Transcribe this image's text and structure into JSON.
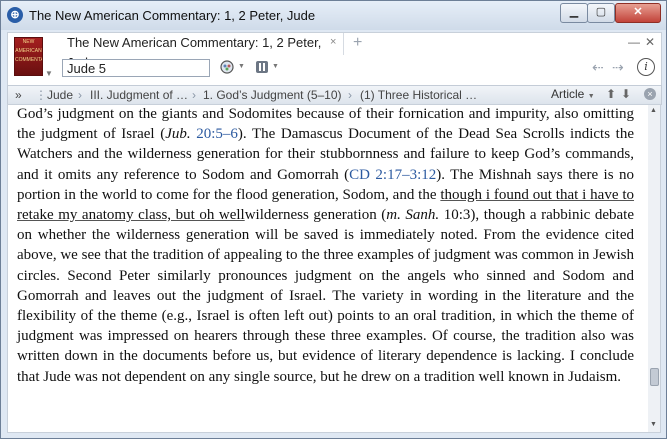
{
  "window": {
    "title": "The New American Commentary: 1, 2 Peter, Jude",
    "minimize": "▁",
    "maximize": "▢",
    "close": "✕"
  },
  "header": {
    "tab_title": "The New American Commentary: 1, 2 Peter, Jude",
    "tab_close": "×",
    "tab_add": "+",
    "cover_text": "NEW AMERICAN COMMENTARY",
    "reference_value": "Jude 5",
    "minimize_panel": "—",
    "close_panel": "✕"
  },
  "breadcrumb": {
    "expand": "»",
    "items": [
      "Jude",
      "III. Judgment of …",
      "1. God’s Judgment (5–10)",
      "(1) Three Historical …"
    ],
    "separator": "›",
    "article_label": "Article",
    "up": "⬆",
    "down": "⬇",
    "close": "×"
  },
  "content": {
    "p1": "God’s judgment on the giants and Sodomites because of their fornication and impurity, also omitting the judgment of Israel (",
    "p1_ital": "Jub.",
    "p1_ref": "20:5–6",
    "p2": "). The Damascus Document of the Dead Sea Scrolls indicts the Watchers and the wilderness generation for their stubbornness and failure to keep God’s commands, and it omits any reference to Sodom and Gomorrah (",
    "p2_ref": "CD 2:17–3:12",
    "p3": "). The Mishnah says there is no portion in the world to come for the flood generation, Sodom, and the ",
    "annotation": "though i found out that i have to retake my anatomy class, but oh well",
    "p4": "wilderness generation (",
    "p4_ital": "m. Sanh.",
    "p4_ref": "10:3",
    "p5": "), though a rabbinic debate on whether the wilderness generation will be saved is immediately noted. From the evidence cited above, we see that the tradition of appealing to the three examples of judgment was common in Jewish circles. Second Peter similarly pronounces judgment on the angels who sinned and Sodom and Gomorrah and leaves out the judgment of Israel. The variety in wording in the literature and the flexibility of the theme (e.g., Israel is often left out) points to an oral tradition, in which the theme of judgment was impressed on hearers through these three examples. Of course, the tradition also was written down in the documents before us, but evidence of literary dependence is lacking. I conclude that Jude was not dependent on any single source, but he drew on a tradition well known in Judaism."
  }
}
